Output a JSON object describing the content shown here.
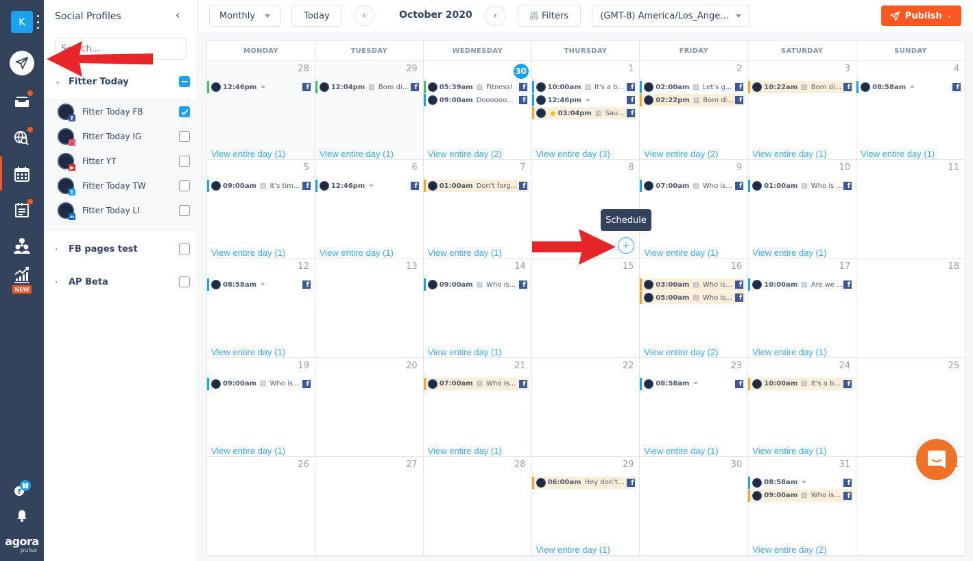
{
  "rail": {
    "account_initial": "K",
    "items": [
      {
        "name": "publish-icon",
        "active": false
      },
      {
        "name": "inbox-icon",
        "badge": true
      },
      {
        "name": "listening-icon",
        "badge": true
      },
      {
        "name": "calendar-icon",
        "active": true
      },
      {
        "name": "reports-icon",
        "badge": true
      },
      {
        "name": "team-icon"
      },
      {
        "name": "analytics-icon",
        "badge_text": "NEW"
      }
    ],
    "new_badge": "NEW",
    "brand_top": "agora",
    "brand_bottom": "pulse"
  },
  "profiles_panel": {
    "title": "Social Profiles",
    "search_placeholder": "Search...",
    "groups": [
      {
        "name": "Fitter Today",
        "state": "partial",
        "expanded": true,
        "profiles": [
          {
            "name": "Fitter Today FB",
            "network": "facebook",
            "checked": true
          },
          {
            "name": "Fitter Today IG",
            "network": "instagram",
            "checked": false
          },
          {
            "name": "Fitter YT",
            "network": "youtube",
            "checked": false
          },
          {
            "name": "Fitter Today TW",
            "network": "twitter",
            "checked": false
          },
          {
            "name": "Fitter Today LI",
            "network": "linkedin",
            "checked": false
          }
        ]
      },
      {
        "name": "FB pages test",
        "state": "unchecked",
        "expanded": false
      },
      {
        "name": "AP Beta",
        "state": "unchecked",
        "expanded": false
      }
    ]
  },
  "toolbar": {
    "view_select": "Monthly",
    "today_label": "Today",
    "month_label": "October 2020",
    "filters_label": "Filters",
    "timezone_select": "(GMT-8) America/Los_Ange...",
    "publish_label": "Publish"
  },
  "calendar": {
    "weekdays": [
      "MONDAY",
      "TUESDAY",
      "WEDNESDAY",
      "THURSDAY",
      "FRIDAY",
      "SATURDAY",
      "SUNDAY"
    ],
    "today": 30,
    "colors": {
      "green": "#3bbf5f",
      "blue": "#1ba1f2",
      "orange": "#f5a431"
    },
    "days": [
      {
        "day": "28",
        "past": true,
        "more": "View entire day (1)",
        "posts": [
          {
            "time": "12:46pm",
            "type": "link",
            "text": "",
            "status": "green"
          }
        ]
      },
      {
        "day": "29",
        "past": true,
        "more": "View entire day (1)",
        "posts": [
          {
            "time": "12:04pm",
            "type": "image",
            "text": "Bom di...",
            "status": "green"
          }
        ]
      },
      {
        "day": "30",
        "today": true,
        "more": "View entire day (2)",
        "posts": [
          {
            "time": "05:39am",
            "type": "image",
            "text": "Fitness!",
            "status": "green"
          },
          {
            "time": "09:00am",
            "type": "text",
            "text": "Doooooo...",
            "status": "blue"
          }
        ]
      },
      {
        "day": "1",
        "more": "View entire day (3)",
        "posts": [
          {
            "time": "10:00am",
            "type": "image",
            "text": "It's a b...",
            "status": "blue"
          },
          {
            "time": "12:46pm",
            "type": "link",
            "text": "",
            "status": "blue"
          },
          {
            "time": "03:04pm",
            "type": "image",
            "text": "Sau...",
            "status": "orange",
            "pending": true
          }
        ]
      },
      {
        "day": "2",
        "more": "View entire day (2)",
        "posts": [
          {
            "time": "02:00am",
            "type": "image",
            "text": "Let's g...",
            "status": "blue"
          },
          {
            "time": "02:22pm",
            "type": "image",
            "text": "Bom di...",
            "status": "orange"
          }
        ]
      },
      {
        "day": "3",
        "more": "View entire day (1)",
        "posts": [
          {
            "time": "10:22am",
            "type": "image",
            "text": "Bom di...",
            "status": "orange"
          }
        ]
      },
      {
        "day": "4",
        "more": "View entire day (1)",
        "posts": [
          {
            "time": "08:58am",
            "type": "link",
            "text": "",
            "status": "blue"
          }
        ]
      },
      {
        "day": "5",
        "more": "View entire day (1)",
        "posts": [
          {
            "time": "09:00am",
            "type": "image",
            "text": "It's tim...",
            "status": "blue"
          }
        ]
      },
      {
        "day": "6",
        "more": "View entire day (1)",
        "posts": [
          {
            "time": "12:46pm",
            "type": "link",
            "text": "",
            "status": "blue"
          }
        ]
      },
      {
        "day": "7",
        "more": "View entire day (1)",
        "posts": [
          {
            "time": "01:00am",
            "type": "text",
            "text": "Don't forg...",
            "status": "orange"
          }
        ]
      },
      {
        "day": "8",
        "more": "",
        "posts": []
      },
      {
        "day": "9",
        "more": "View entire day (1)",
        "posts": [
          {
            "time": "07:00am",
            "type": "image",
            "text": "Who is...",
            "status": "blue"
          }
        ]
      },
      {
        "day": "10",
        "more": "View entire day (1)",
        "posts": [
          {
            "time": "01:00am",
            "type": "image",
            "text": "Who is ...",
            "status": "blue"
          }
        ]
      },
      {
        "day": "11",
        "more": "",
        "posts": []
      },
      {
        "day": "12",
        "more": "View entire day (1)",
        "posts": [
          {
            "time": "08:58am",
            "type": "link",
            "text": "",
            "status": "blue"
          }
        ]
      },
      {
        "day": "13",
        "more": "",
        "posts": []
      },
      {
        "day": "14",
        "more": "View entire day (1)",
        "posts": [
          {
            "time": "09:00am",
            "type": "image",
            "text": "Who is...",
            "status": "blue"
          }
        ]
      },
      {
        "day": "15",
        "more": "",
        "posts": []
      },
      {
        "day": "16",
        "more": "View entire day (2)",
        "posts": [
          {
            "time": "03:00am",
            "type": "image",
            "text": "Who is...",
            "status": "orange"
          },
          {
            "time": "05:00am",
            "type": "image",
            "text": "Who is...",
            "status": "orange"
          }
        ]
      },
      {
        "day": "17",
        "more": "View entire day (1)",
        "posts": [
          {
            "time": "10:00am",
            "type": "image",
            "text": "Are we ...",
            "status": "blue"
          }
        ]
      },
      {
        "day": "18",
        "more": "",
        "posts": []
      },
      {
        "day": "19",
        "more": "View entire day (1)",
        "posts": [
          {
            "time": "09:00am",
            "type": "image",
            "text": "Who is...",
            "status": "blue"
          }
        ]
      },
      {
        "day": "20",
        "more": "",
        "posts": []
      },
      {
        "day": "21",
        "more": "View entire day (1)",
        "posts": [
          {
            "time": "07:00am",
            "type": "image",
            "text": "Who is...",
            "status": "orange"
          }
        ]
      },
      {
        "day": "22",
        "more": "",
        "posts": []
      },
      {
        "day": "23",
        "more": "View entire day (1)",
        "posts": [
          {
            "time": "08:58am",
            "type": "link",
            "text": "",
            "status": "blue"
          }
        ]
      },
      {
        "day": "24",
        "more": "View entire day (1)",
        "posts": [
          {
            "time": "10:00am",
            "type": "image",
            "text": "It's a b...",
            "status": "orange"
          }
        ]
      },
      {
        "day": "25",
        "more": "",
        "posts": []
      },
      {
        "day": "26",
        "more": "",
        "posts": []
      },
      {
        "day": "27",
        "more": "",
        "posts": []
      },
      {
        "day": "28",
        "more": "",
        "posts": []
      },
      {
        "day": "29",
        "more": "View entire day (1)",
        "posts": [
          {
            "time": "06:00am",
            "type": "text",
            "text": "Hey don't ...",
            "status": "orange"
          }
        ]
      },
      {
        "day": "30",
        "more": "",
        "posts": []
      },
      {
        "day": "31",
        "more": "View entire day (2)",
        "posts": [
          {
            "time": "08:58am",
            "type": "link",
            "text": "",
            "status": "blue"
          },
          {
            "time": "09:00am",
            "type": "image",
            "text": "Who is...",
            "status": "orange"
          }
        ]
      },
      {
        "day": "1",
        "more": "",
        "posts": []
      }
    ]
  },
  "tooltip": {
    "label": "Schedule"
  },
  "colors": {
    "accent": "#ff5722",
    "link": "#40a4ee",
    "rail": "#34435c",
    "facebook": "#3b5998",
    "chat": "#f07229"
  }
}
